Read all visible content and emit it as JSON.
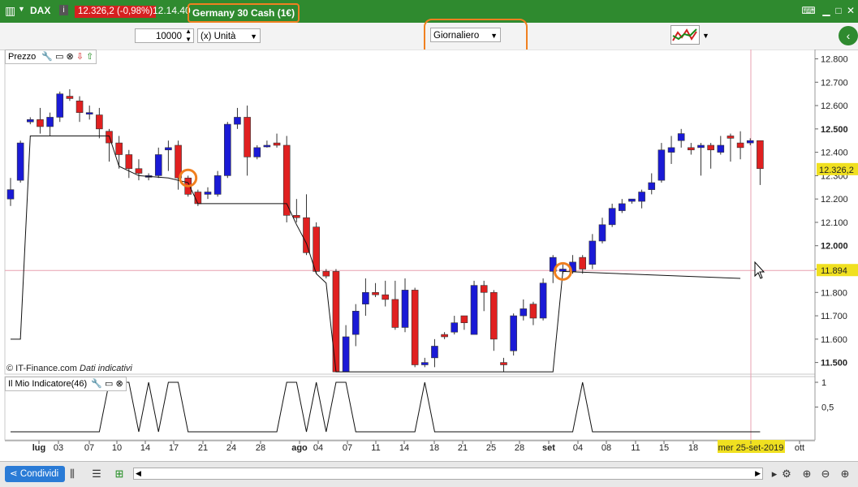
{
  "titlebar": {
    "symbol": "DAX",
    "price_change": "12.326,2 (-0,98%)",
    "time": "12.14.40",
    "instrument": "Germany 30 Cash (1€)",
    "info_icon": "info-icon"
  },
  "toolbar": {
    "quantity": "10000",
    "unit": "(x) Unità",
    "period": "Giornaliero"
  },
  "panels": {
    "price_label": "Prezzo",
    "indicator_label": "Il Mio Indicatore(46)"
  },
  "copyright": {
    "source": "© IT-Finance.com",
    "note": "Dati indicativi"
  },
  "bottom": {
    "share": "Condividi"
  },
  "colors": {
    "bull": "#1a1ad6",
    "bear": "#e02020",
    "accent": "#f08020",
    "titlebar": "#2f8a2f",
    "last_price_badge": "#f0e020"
  },
  "chart_data": [
    {
      "type": "candlestick",
      "title": "Prezzo",
      "y_ticks": [
        "12.800",
        "12.700",
        "12.600",
        "12.500",
        "12.400",
        "12.300",
        "12.200",
        "12.100",
        "12.000",
        "11.900",
        "11.800",
        "11.700",
        "11.600",
        "11.500"
      ],
      "y_bold_ticks": [
        "12.500",
        "12.000",
        "11.500"
      ],
      "ylim": [
        11.45,
        12.84
      ],
      "last_price_label": "12.326,2",
      "crosshair_price_label": "11.894",
      "crosshair_price": 11.894,
      "x_labels": [
        "lug",
        "03",
        "07",
        "10",
        "14",
        "17",
        "21",
        "24",
        "28",
        "ago",
        "04",
        "07",
        "11",
        "14",
        "18",
        "21",
        "25",
        "28",
        "set",
        "04",
        "08",
        "11",
        "15",
        "18",
        "mer 25-set-2019",
        "ott"
      ],
      "x_bold_labels": [
        "lug",
        "ago",
        "set"
      ],
      "candles": [
        [
          12.2,
          12.24,
          12.29,
          12.17
        ],
        [
          12.28,
          12.44,
          12.45,
          12.27
        ],
        [
          12.53,
          12.54,
          12.55,
          12.52
        ],
        [
          12.54,
          12.51,
          12.59,
          12.48
        ],
        [
          12.51,
          12.55,
          12.57,
          12.47
        ],
        [
          12.55,
          12.65,
          12.66,
          12.53
        ],
        [
          12.64,
          12.63,
          12.67,
          12.62
        ],
        [
          12.62,
          12.57,
          12.64,
          12.53
        ],
        [
          12.57,
          12.57,
          12.6,
          12.54
        ],
        [
          12.56,
          12.5,
          12.59,
          12.46
        ],
        [
          12.49,
          12.44,
          12.5,
          12.36
        ],
        [
          12.44,
          12.39,
          12.47,
          12.33
        ],
        [
          12.39,
          12.33,
          12.41,
          12.29
        ],
        [
          12.33,
          12.31,
          12.37,
          12.28
        ],
        [
          12.3,
          12.3,
          12.31,
          12.28
        ],
        [
          12.3,
          12.39,
          12.42,
          12.29
        ],
        [
          12.41,
          12.42,
          12.45,
          12.32
        ],
        [
          12.43,
          12.29,
          12.45,
          12.24
        ],
        [
          12.29,
          12.22,
          12.3,
          12.21
        ],
        [
          12.23,
          12.18,
          12.24,
          12.17
        ],
        [
          12.22,
          12.23,
          12.25,
          12.2
        ],
        [
          12.22,
          12.3,
          12.32,
          12.21
        ],
        [
          12.3,
          12.52,
          12.53,
          12.29
        ],
        [
          12.52,
          12.55,
          12.59,
          12.5
        ],
        [
          12.55,
          12.38,
          12.6,
          12.3
        ],
        [
          12.38,
          12.42,
          12.43,
          12.37
        ],
        [
          12.43,
          12.43,
          12.45,
          12.42
        ],
        [
          12.44,
          12.43,
          12.48,
          12.42
        ],
        [
          12.43,
          12.13,
          12.47,
          12.1
        ],
        [
          12.13,
          12.12,
          12.2,
          12.1
        ],
        [
          12.12,
          11.97,
          12.22,
          11.96
        ],
        [
          12.08,
          11.89,
          12.1,
          11.88
        ],
        [
          11.89,
          11.87,
          11.9,
          11.86
        ],
        [
          11.89,
          11.46,
          11.9,
          11.46
        ],
        [
          11.46,
          11.61,
          11.66,
          11.46
        ],
        [
          11.62,
          11.72,
          11.75,
          11.57
        ],
        [
          11.75,
          11.8,
          11.86,
          11.7
        ],
        [
          11.8,
          11.79,
          11.84,
          11.78
        ],
        [
          11.79,
          11.77,
          11.85,
          11.74
        ],
        [
          11.77,
          11.65,
          11.85,
          11.64
        ],
        [
          11.65,
          11.81,
          11.86,
          11.63
        ],
        [
          11.81,
          11.49,
          11.82,
          11.48
        ],
        [
          11.49,
          11.5,
          11.52,
          11.48
        ],
        [
          11.52,
          11.57,
          11.6,
          11.48
        ],
        [
          11.62,
          11.61,
          11.63,
          11.6
        ],
        [
          11.63,
          11.67,
          11.7,
          11.62
        ],
        [
          11.7,
          11.67,
          11.7,
          11.64
        ],
        [
          11.62,
          11.83,
          11.85,
          11.62
        ],
        [
          11.83,
          11.8,
          11.85,
          11.72
        ],
        [
          11.8,
          11.6,
          11.81,
          11.55
        ],
        [
          11.5,
          11.49,
          11.52,
          11.46
        ],
        [
          11.55,
          11.7,
          11.71,
          11.53
        ],
        [
          11.7,
          11.73,
          11.77,
          11.68
        ],
        [
          11.75,
          11.69,
          11.76,
          11.66
        ],
        [
          11.69,
          11.84,
          11.86,
          11.68
        ],
        [
          11.89,
          11.95,
          11.96,
          11.84
        ],
        [
          11.89,
          11.9,
          11.92,
          11.88
        ],
        [
          11.89,
          11.93,
          11.96,
          11.88
        ],
        [
          11.95,
          11.9,
          11.96,
          11.88
        ],
        [
          11.92,
          12.02,
          12.05,
          11.9
        ],
        [
          12.02,
          12.09,
          12.12,
          12.01
        ],
        [
          12.09,
          12.16,
          12.18,
          12.08
        ],
        [
          12.15,
          12.18,
          12.2,
          12.14
        ],
        [
          12.19,
          12.2,
          12.2,
          12.18
        ],
        [
          12.19,
          12.23,
          12.24,
          12.16
        ],
        [
          12.24,
          12.27,
          12.31,
          12.22
        ],
        [
          12.28,
          12.41,
          12.44,
          12.27
        ],
        [
          12.4,
          12.42,
          12.47,
          12.35
        ],
        [
          12.45,
          12.48,
          12.5,
          12.42
        ],
        [
          12.42,
          12.41,
          12.44,
          12.39
        ],
        [
          12.42,
          12.43,
          12.44,
          12.3
        ],
        [
          12.43,
          12.41,
          12.44,
          12.33
        ],
        [
          12.4,
          12.43,
          12.47,
          12.39
        ],
        [
          12.47,
          12.46,
          12.48,
          12.36
        ],
        [
          12.44,
          12.42,
          12.49,
          12.37
        ],
        [
          12.44,
          12.45,
          12.46,
          12.43
        ],
        [
          12.45,
          12.33,
          12.45,
          12.26
        ]
      ],
      "overlay_line": [
        [
          0,
          11.6
        ],
        [
          1,
          11.6
        ],
        [
          2,
          12.47
        ],
        [
          10,
          12.47
        ],
        [
          11,
          12.34
        ],
        [
          13,
          12.3
        ],
        [
          16,
          12.29
        ],
        [
          18,
          12.27
        ],
        [
          19,
          12.18
        ],
        [
          28,
          12.18
        ],
        [
          29,
          12.09
        ],
        [
          30,
          12.01
        ],
        [
          31,
          11.88
        ],
        [
          32,
          11.84
        ],
        [
          33,
          11.46
        ],
        [
          55,
          11.46
        ],
        [
          56,
          11.89
        ],
        [
          74,
          11.86
        ]
      ]
    },
    {
      "type": "line",
      "title": "Il Mio Indicatore(46)",
      "y_ticks": [
        "1",
        "0,5"
      ],
      "ylim": [
        0,
        1
      ],
      "values": [
        0,
        0,
        0,
        0,
        0,
        0,
        0,
        0,
        0,
        0,
        1,
        1,
        1,
        0,
        1,
        0,
        1,
        1,
        0,
        0,
        0,
        0,
        0,
        0,
        0,
        0,
        0,
        0,
        1,
        1,
        0,
        1,
        0,
        1,
        1,
        0,
        0,
        0,
        0,
        0,
        0,
        0,
        1,
        0,
        0,
        0,
        0,
        0,
        0,
        0,
        0,
        0,
        0,
        0,
        0,
        0,
        0,
        0,
        1,
        0,
        0,
        0,
        0,
        0,
        0,
        0,
        0,
        0,
        0,
        0,
        0,
        0,
        0,
        0,
        0,
        0,
        0
      ]
    }
  ]
}
